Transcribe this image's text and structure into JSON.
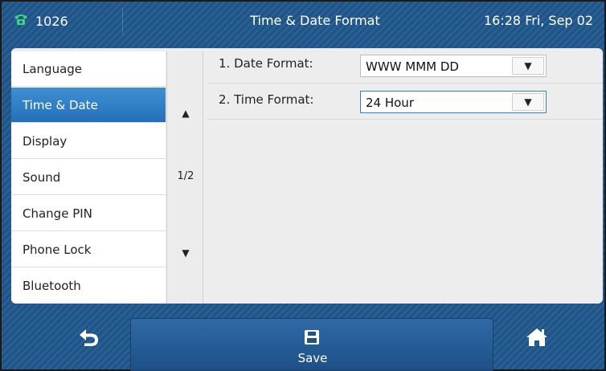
{
  "status_bar": {
    "account": "1026",
    "title": "Time & Date Format",
    "clock": "16:28 Fri, Sep 02"
  },
  "sidebar": {
    "items": [
      {
        "label": "Language"
      },
      {
        "label": "Time & Date"
      },
      {
        "label": "Display"
      },
      {
        "label": "Sound"
      },
      {
        "label": "Change PIN"
      },
      {
        "label": "Phone Lock"
      },
      {
        "label": "Bluetooth"
      }
    ],
    "active_item": "Time & Date"
  },
  "pager": {
    "page": "1/2",
    "up_icon": "triangle-up-icon",
    "down_icon": "triangle-down-icon"
  },
  "settings": {
    "rows": [
      {
        "label": "1. Date Format:",
        "value": "WWW MMM DD"
      },
      {
        "label": "2. Time Format:",
        "value": "24 Hour"
      }
    ]
  },
  "softkeys": {
    "back_icon": "back-arrow-icon",
    "save_icon": "floppy-disk-icon",
    "save_label": "Save",
    "home_icon": "home-icon"
  },
  "colors": {
    "accent": "#2f7fcf",
    "active_item_bg": "#2470b8",
    "bar_bg": "#1f5285"
  }
}
